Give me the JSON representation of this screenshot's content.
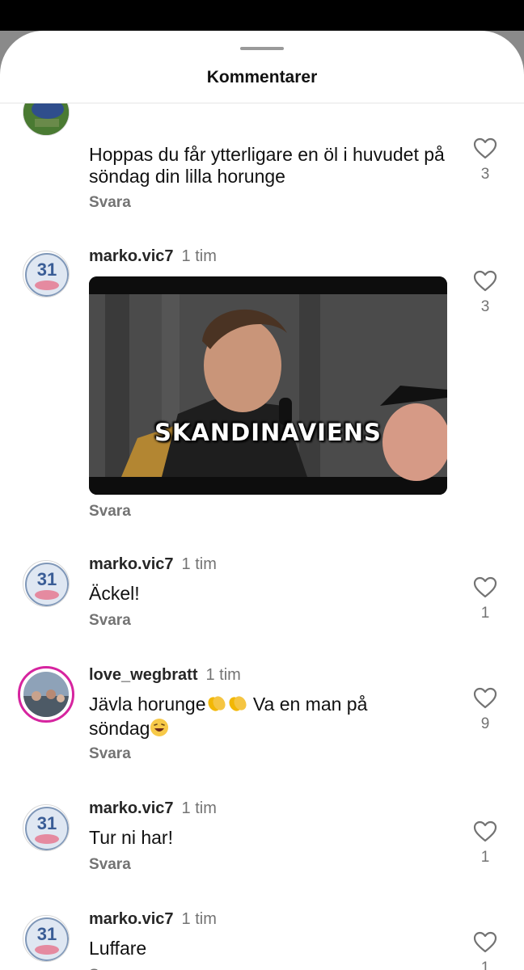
{
  "title": "Kommentarer",
  "reply_label": "Svara",
  "colors": {
    "accent_ring": "#d6249f",
    "muted_text": "#737373"
  },
  "comments": [
    {
      "username": "",
      "time": "",
      "text": "Hoppas du får ytterligare en öl i huvudet på söndag din lilla horunge",
      "likes": "3"
    },
    {
      "username": "marko.vic7",
      "time": "1 tim",
      "gif_caption": "SKANDINAVIENS",
      "likes": "3"
    },
    {
      "username": "marko.vic7",
      "time": "1 tim",
      "text": "Äckel!",
      "likes": "1"
    },
    {
      "username": "love_wegbratt",
      "time": "1 tim",
      "text": "Jävla horunge",
      "text_after_emoji": " Va en man på",
      "text_line2": "söndag",
      "likes": "9"
    },
    {
      "username": "marko.vic7",
      "time": "1 tim",
      "text": "Tur ni har!",
      "likes": "1"
    },
    {
      "username": "marko.vic7",
      "time": "1 tim",
      "text": "Luffare",
      "likes": "1"
    }
  ]
}
